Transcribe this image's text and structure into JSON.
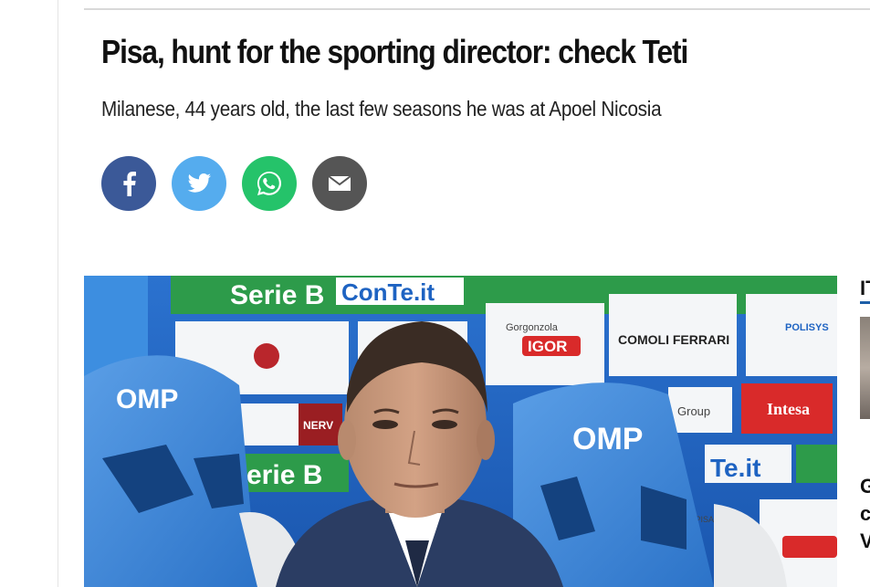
{
  "article": {
    "title": "Pisa, hunt for the sporting director: check Teti",
    "subtitle": "Milanese, 44 years old, the last few seasons he was at Apoel Nicosia"
  },
  "share": {
    "facebook": "facebook-icon",
    "twitter": "twitter-icon",
    "whatsapp": "whatsapp-icon",
    "email": "email-icon"
  },
  "photo": {
    "backdrop": {
      "serie_b_top": "Serie B",
      "conte_top": "ConTe.it",
      "serie_b_mid": "erie B",
      "conte_mid": "Te.it",
      "sponsors": [
        "Gorgonzola",
        "IGOR",
        "COMOLI FERRARI",
        "POLISYS",
        "Intesa",
        "Group",
        "NERV",
        "BANCA DI PISA"
      ],
      "chair_brand": "OMP"
    }
  },
  "sidebar": {
    "heading": "IT",
    "lines": [
      "G",
      "c",
      "V"
    ]
  },
  "colors": {
    "facebook": "#3b5998",
    "twitter": "#55acee",
    "whatsapp": "#25c36a",
    "email": "#555555",
    "backdrop_blue": "#1e63c2",
    "chair_blue": "#3a86d8",
    "serie_b_green": "#2d9b4a",
    "igor_red": "#d92a2a"
  }
}
